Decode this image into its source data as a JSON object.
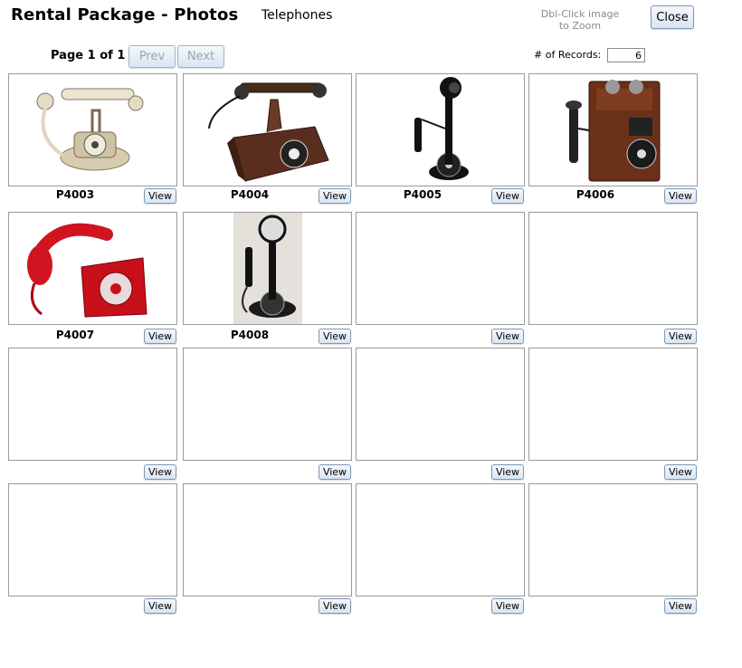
{
  "header": {
    "title": "Rental Package - Photos",
    "category": "Telephones",
    "hint_line1": "Dbl-Click image",
    "hint_line2": "to Zoom",
    "close_label": "Close"
  },
  "pager": {
    "page_word": "Page",
    "page": "1",
    "of_word": "of",
    "total": "1",
    "prev_label": "Prev",
    "next_label": "Next",
    "records_label": "# of Records:",
    "records_value": "6"
  },
  "grid": {
    "view_label": "View",
    "cells": [
      {
        "code": "P4003",
        "photo": "french-phone"
      },
      {
        "code": "P4004",
        "photo": "wood-phone"
      },
      {
        "code": "P4005",
        "photo": "candlestick-phone"
      },
      {
        "code": "P4006",
        "photo": "wall-phone"
      },
      {
        "code": "P4007",
        "photo": "red-phone"
      },
      {
        "code": "P4008",
        "photo": "candlestick-phone-2"
      },
      {
        "code": "",
        "photo": ""
      },
      {
        "code": "",
        "photo": ""
      },
      {
        "code": "",
        "photo": ""
      },
      {
        "code": "",
        "photo": ""
      },
      {
        "code": "",
        "photo": ""
      },
      {
        "code": "",
        "photo": ""
      },
      {
        "code": "",
        "photo": ""
      },
      {
        "code": "",
        "photo": ""
      },
      {
        "code": "",
        "photo": ""
      },
      {
        "code": "",
        "photo": ""
      }
    ]
  }
}
